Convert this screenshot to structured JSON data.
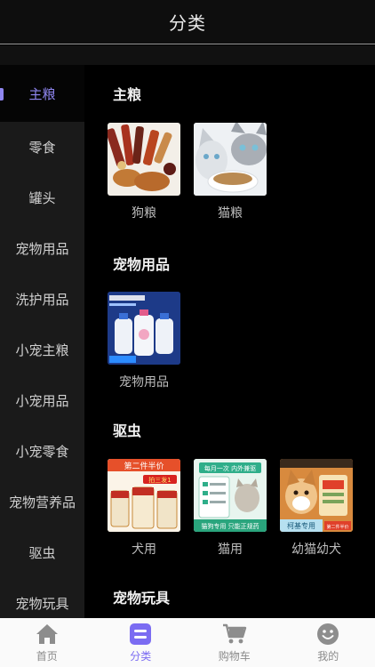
{
  "header": {
    "title": "分类"
  },
  "sidebar": {
    "items": [
      {
        "label": "主粮"
      },
      {
        "label": "零食"
      },
      {
        "label": "罐头"
      },
      {
        "label": "宠物用品"
      },
      {
        "label": "洗护用品"
      },
      {
        "label": "小宠主粮"
      },
      {
        "label": "小宠用品"
      },
      {
        "label": "小宠零食"
      },
      {
        "label": "宠物营养品"
      },
      {
        "label": "驱虫"
      },
      {
        "label": "宠物玩具"
      }
    ]
  },
  "content": {
    "sections": [
      {
        "title": "主粮",
        "items": [
          {
            "label": "狗粮",
            "icon": "dog-food-photo"
          },
          {
            "label": "猫粮",
            "icon": "cat-food-photo"
          }
        ]
      },
      {
        "title": "宠物用品",
        "items": [
          {
            "label": "宠物用品",
            "icon": "shampoo-bottles-photo"
          }
        ]
      },
      {
        "title": "驱虫",
        "items": [
          {
            "label": "犬用",
            "icon": "dog-deworm-photo",
            "banner": "第二件半价",
            "tag": "拍三发1"
          },
          {
            "label": "猫用",
            "icon": "cat-deworm-photo",
            "banner": "每月一次 内外兼驱",
            "footer": "猫狗专用 只能正规药"
          },
          {
            "label": "幼猫幼犬",
            "icon": "puppy-food-photo",
            "footer": "柯基专用",
            "badge": "第二件半价"
          }
        ]
      },
      {
        "title": "宠物玩具"
      }
    ]
  },
  "tabbar": {
    "tabs": [
      {
        "label": "首页",
        "icon": "home-icon"
      },
      {
        "label": "分类",
        "icon": "category-icon"
      },
      {
        "label": "购物车",
        "icon": "cart-icon"
      },
      {
        "label": "我的",
        "icon": "smiley-icon"
      }
    ]
  },
  "colors": {
    "accent": "#7b6cf2",
    "active_side": "#8f86f0",
    "sidebar_bg": "#1a1a1a",
    "tabbar_bg": "#fafafa"
  }
}
